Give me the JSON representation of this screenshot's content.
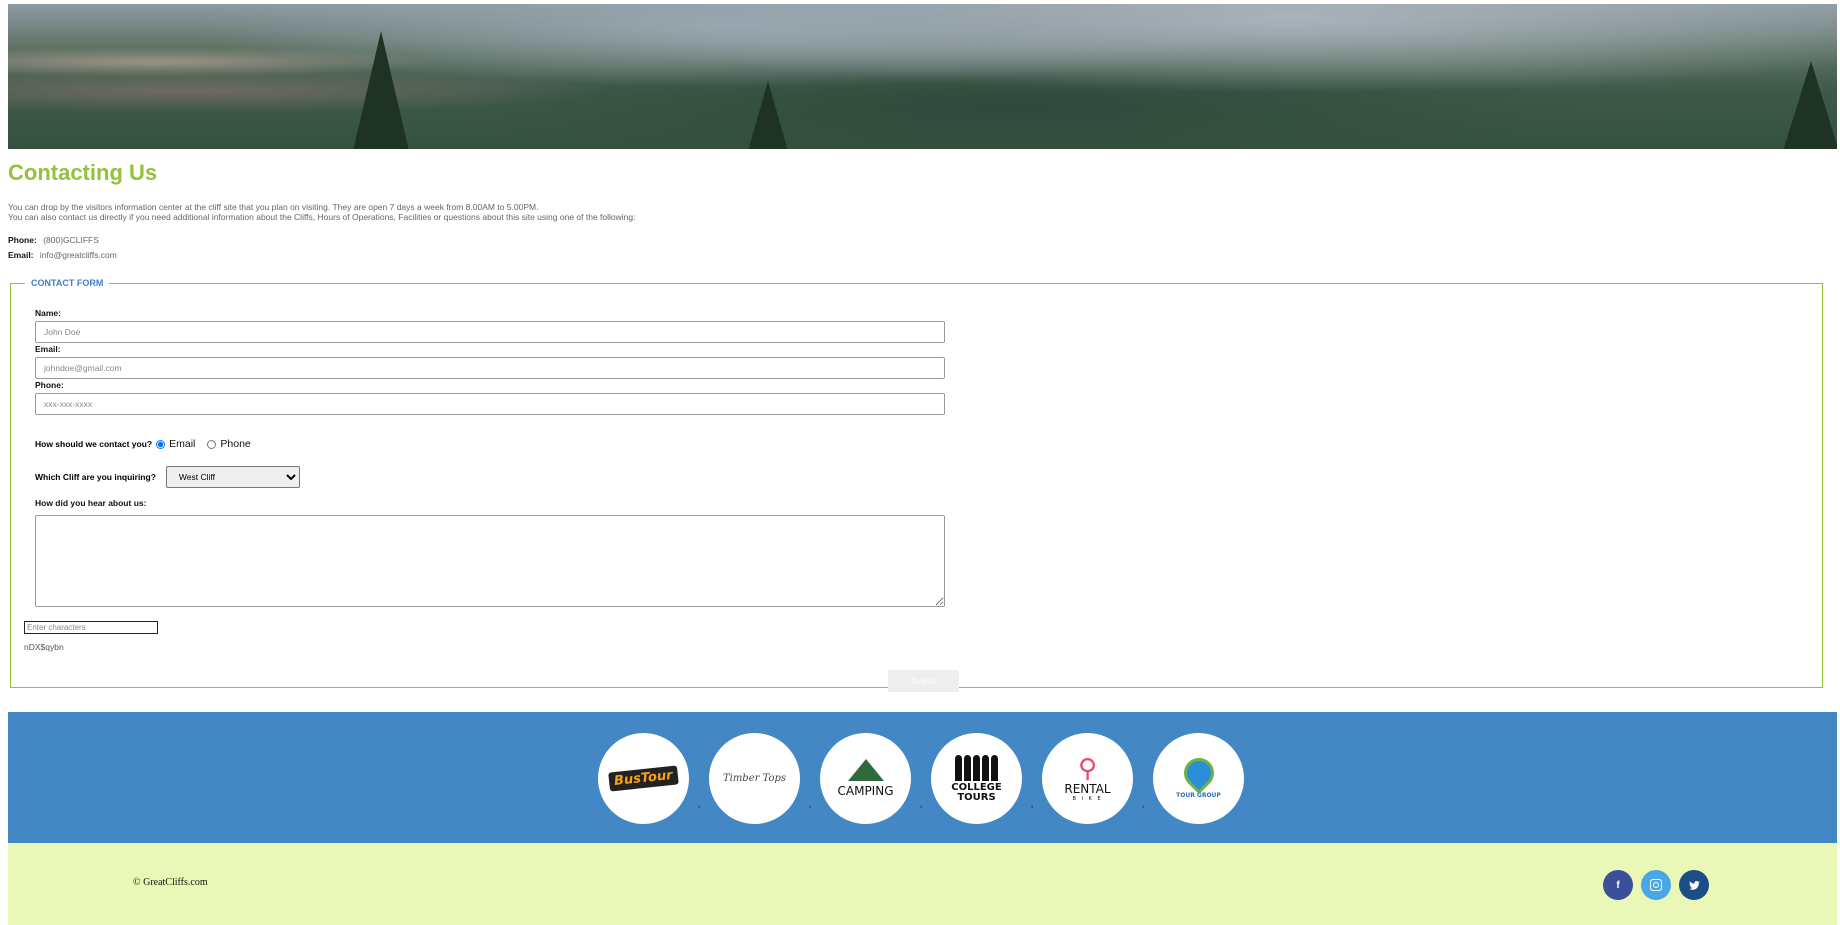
{
  "page": {
    "title": "Contacting Us",
    "intro_line1": "You can drop by the visitors information center at the cliff site that you plan on visiting. They are open 7 days a week from 8.00AM to 5.00PM.",
    "intro_line2": "You can also contact us directly if you need additional information about the Cliffs, Hours of Operations, Facilities or questions about this site using one of the following:"
  },
  "contact": {
    "phone_label": "Phone:",
    "phone_value": "(800)GCLIFFS",
    "email_label": "Email:",
    "email_value": "info@greatcliffs.com"
  },
  "form": {
    "legend": "CONTACT FORM",
    "name_label": "Name:",
    "name_placeholder": "John Doe",
    "email_label": "Email:",
    "email_placeholder": "johndoe@gmail.com",
    "phone_label": "Phone:",
    "phone_placeholder": "xxx-xxx-xxxx",
    "contact_question": "How should we contact you?",
    "contact_options": [
      "Email",
      "Phone"
    ],
    "contact_selected": "Email",
    "cliff_question": "Which Cliff are you inquiring?",
    "cliff_selected": "West Cliff",
    "hear_question": "How did you hear about us:",
    "captcha_placeholder": "Enter characters",
    "captcha_code": "nDX$qybn",
    "submit_label": "Submit"
  },
  "partners": {
    "separator": ",",
    "logos": [
      {
        "name": "bus-tour",
        "text": "BusTour"
      },
      {
        "name": "timber-tops",
        "text": "Timber Tops"
      },
      {
        "name": "camping",
        "text": "CAMPING"
      },
      {
        "name": "college-tours",
        "text": "COLLEGE TOURS"
      },
      {
        "name": "rental-bike",
        "text": "RENTAL",
        "sub": "B I K E"
      },
      {
        "name": "tour-group",
        "text": "TOUR GROUP"
      }
    ]
  },
  "footer": {
    "copyright": "© GreatCliffs.com",
    "social": [
      "facebook-icon",
      "instagram-icon",
      "twitter-icon"
    ]
  },
  "colors": {
    "title_green": "#94c23a",
    "legend_blue": "#3d7fc4",
    "partners_bg": "#4387c4",
    "footer_bg": "#e9f8b7"
  }
}
